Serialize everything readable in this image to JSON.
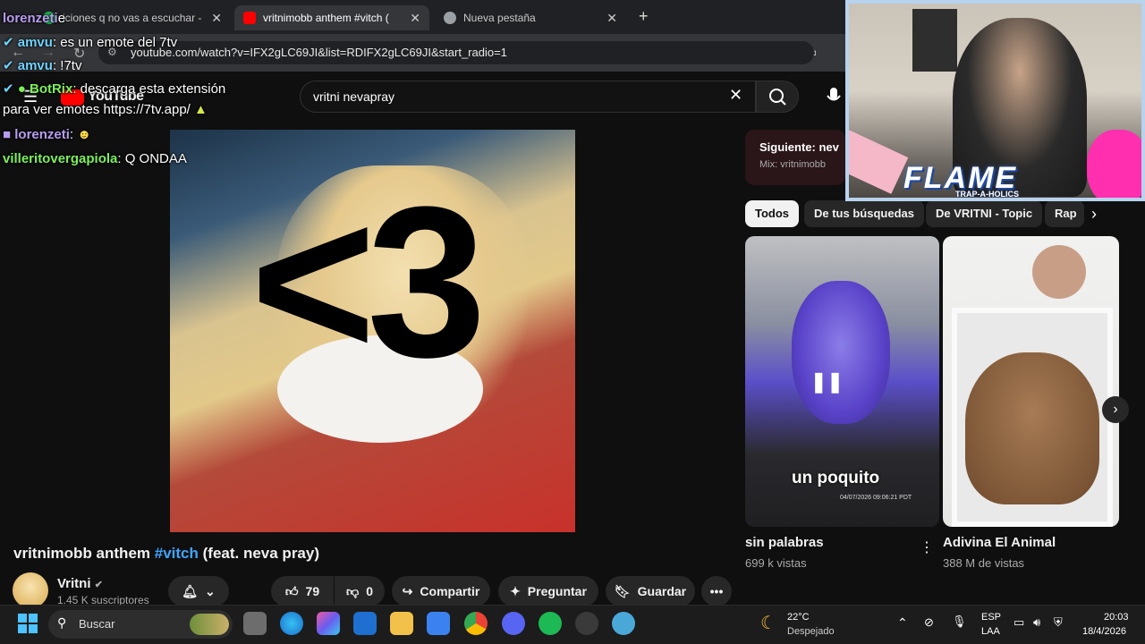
{
  "browser": {
    "tabs": [
      {
        "label": "iciones q no vas a escuchar -",
        "active": false
      },
      {
        "label": "vritnimobb anthem #vitch (",
        "active": true
      },
      {
        "label": "Nueva pestaña",
        "active": false
      }
    ],
    "new_tab": "+",
    "url": "youtube.com/watch?v=IFX2gLC69JI&list=RDIFX2gLC69JI&start_radio=1"
  },
  "youtube": {
    "logo": "YouTube",
    "search_value": "vritni nevapray",
    "video": {
      "overlay_text": "<3",
      "title_prefix": "vritnimobb anthem",
      "title_tag": "#vitch",
      "title_suffix": "(feat. neva pray)"
    },
    "channel": {
      "name": "Vritni",
      "subscribers": "1.45 K suscriptores"
    },
    "actions": {
      "likes": "79",
      "dislikes": "0",
      "share": "Compartir",
      "ask": "Preguntar",
      "save": "Guardar",
      "more": "•••"
    },
    "next": {
      "label": "Siguiente: nev",
      "mix": "Mix: vritnimobb"
    },
    "chips": [
      "Todos",
      "De tus búsquedas",
      "De VRITNI - Topic",
      "Rap"
    ],
    "shorts": [
      {
        "title": "sin palabras",
        "views": "699 k vistas",
        "caption": "un poquito",
        "stamp": "04/07/2026 09:06:21 PDT"
      },
      {
        "title": "Adivina El Animal",
        "views": "388 M de vistas"
      }
    ]
  },
  "chat": [
    {
      "user": "lorenzeti",
      "message": "e",
      "user_color": "#b89cf0"
    },
    {
      "user": "amvu",
      "message": ": es un emote del 7tv",
      "user_color": "#6fd3ff"
    },
    {
      "user": "amvu",
      "message": ": !7tv",
      "user_color": "#6fd3ff"
    },
    {
      "user": "BotRix",
      "message": ": descarga esta extensión",
      "user_color": "#7cf05a"
    },
    {
      "user": "",
      "message": "para ver emotes https://7tv.app/",
      "user_color": "#ffffff"
    },
    {
      "user": "lorenzeti",
      "message": ":",
      "user_color": "#b89cf0"
    },
    {
      "user": "villeritovergapiola",
      "message": ": Q ONDAA",
      "user_color": "#7cf05a"
    }
  ],
  "webcam": {
    "overlay_title": "FLAME",
    "overlay_sub": "TRAP-A-HOLICS"
  },
  "taskbar": {
    "search": "Buscar",
    "weather_temp": "22°C",
    "weather_text": "Despejado",
    "lang": "ESP",
    "lang2": "LAA",
    "time": "20:03",
    "date": "18/4/2026"
  },
  "colors": {
    "accent_link": "#3ea6ff",
    "chip_selected": "#f1f1f1",
    "taskbar": "#1c1c1c"
  }
}
